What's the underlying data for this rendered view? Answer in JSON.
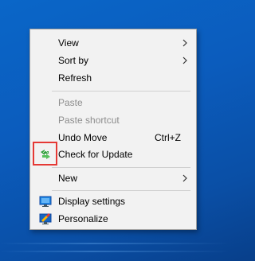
{
  "menu": {
    "items": [
      {
        "label": "View",
        "submenu": true
      },
      {
        "label": "Sort by",
        "submenu": true
      },
      {
        "label": "Refresh"
      },
      {
        "label": "Paste",
        "disabled": true
      },
      {
        "label": "Paste shortcut",
        "disabled": true
      },
      {
        "label": "Undo Move",
        "shortcut": "Ctrl+Z"
      },
      {
        "label": "Check for Update",
        "icon": "update-icon"
      },
      {
        "label": "New",
        "submenu": true
      },
      {
        "label": "Display settings",
        "icon": "display-icon"
      },
      {
        "label": "Personalize",
        "icon": "personalize-icon"
      }
    ]
  },
  "colors": {
    "highlight_border": "#e53935",
    "desktop": "#0a5fc4"
  }
}
